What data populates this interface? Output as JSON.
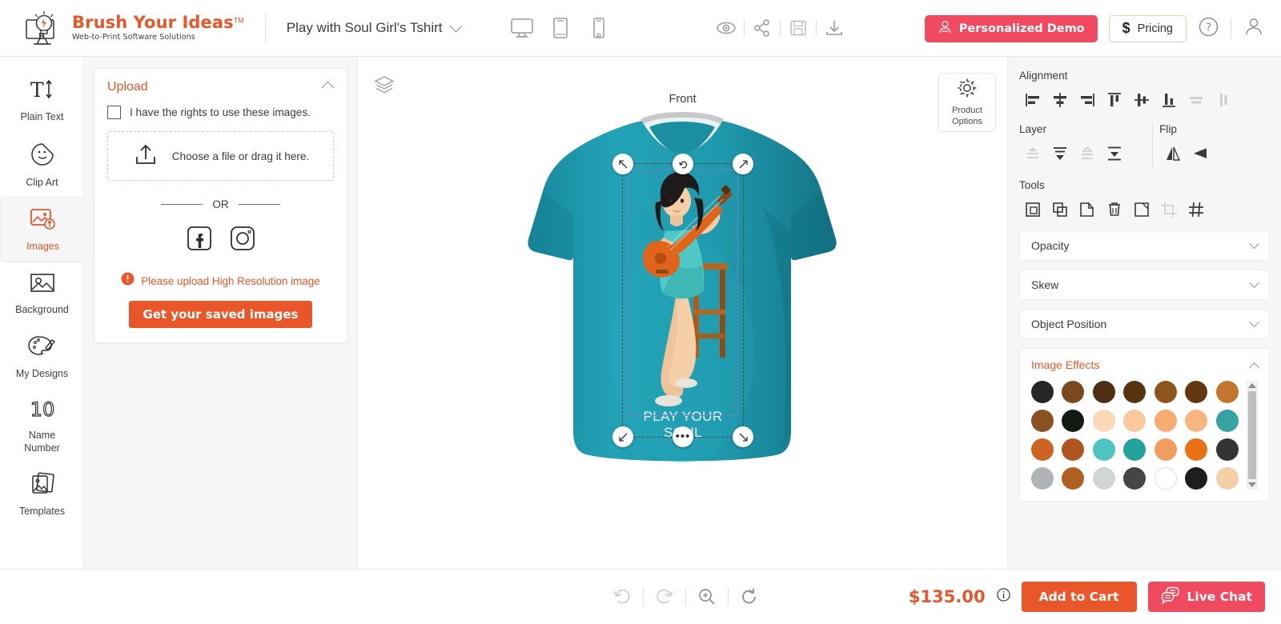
{
  "header": {
    "logo_title": "Brush Your Ideas",
    "logo_tm": "TM",
    "logo_sub": "Web-to-Print Software Solutions",
    "doc_title": "Play with Soul Girl's Tshirt",
    "devices": [
      {
        "name": "desktop-view",
        "label": "Desktop"
      },
      {
        "name": "tablet-view",
        "label": "Tablet"
      },
      {
        "name": "mobile-view",
        "label": "Mobile"
      }
    ],
    "actions": [
      {
        "name": "preview-icon",
        "label": "Preview"
      },
      {
        "name": "share-icon",
        "label": "Share"
      },
      {
        "name": "save-icon",
        "label": "Save"
      },
      {
        "name": "download-icon",
        "label": "Download"
      }
    ],
    "demo_button": "Personalized Demo",
    "pricing_button": "Pricing",
    "help_icon": "help-circle-icon",
    "account_icon": "user-account-icon"
  },
  "sidebar": {
    "items": [
      {
        "label": "Plain Text",
        "icon": "plain-text-icon",
        "active": false
      },
      {
        "label": "Clip Art",
        "icon": "clip-art-icon",
        "active": false
      },
      {
        "label": "Images",
        "icon": "images-icon",
        "active": true
      },
      {
        "label": "Background",
        "icon": "background-icon",
        "active": false
      },
      {
        "label": "My Designs",
        "icon": "palette-icon",
        "active": false
      },
      {
        "label": "Name\nNumber",
        "icon": "name-number-icon",
        "active": false
      },
      {
        "label": "Templates",
        "icon": "templates-icon",
        "active": false
      }
    ],
    "name_number_line1": "Name",
    "name_number_line2": "Number",
    "name_number_glyph": "10"
  },
  "upload_panel": {
    "title": "Upload",
    "rights_checkbox_label": "I have the rights to use these images.",
    "rights_checked": false,
    "dropzone_text": "Choose a file or drag it here.",
    "or_text": "OR",
    "social": [
      {
        "name": "facebook-icon",
        "label": "Facebook"
      },
      {
        "name": "instagram-icon",
        "label": "Instagram"
      }
    ],
    "warning_text": "Please upload High Resolution image",
    "saved_images_button": "Get your saved images"
  },
  "canvas": {
    "layers_icon": "layers-icon",
    "side_label": "Front",
    "design_text": "PLAY YOUR SOUL",
    "shirt_color": "#1f9bb0",
    "selection": {
      "handles": [
        {
          "name": "rotate-handle",
          "glyph": "↖"
        },
        {
          "name": "flip-handle",
          "glyph": "↻"
        },
        {
          "name": "resize-handle-tr",
          "glyph": "↗"
        },
        {
          "name": "resize-handle-bl",
          "glyph": "↙"
        },
        {
          "name": "more-options-handle",
          "glyph": "•••"
        },
        {
          "name": "resize-handle-br",
          "glyph": "↘"
        }
      ]
    }
  },
  "product_options": {
    "line1": "Product",
    "line2": "Options",
    "icon": "gear-icon"
  },
  "right_panel": {
    "alignment_title": "Alignment",
    "alignment_buttons": [
      {
        "name": "align-left-icon",
        "enabled": true
      },
      {
        "name": "align-center-horizontal-icon",
        "enabled": true
      },
      {
        "name": "align-right-icon",
        "enabled": true
      },
      {
        "name": "align-top-icon",
        "enabled": true
      },
      {
        "name": "align-middle-vertical-icon",
        "enabled": true
      },
      {
        "name": "align-bottom-icon",
        "enabled": true
      },
      {
        "name": "distribute-horizontal-icon",
        "enabled": false
      },
      {
        "name": "distribute-vertical-icon",
        "enabled": false
      }
    ],
    "layer_title": "Layer",
    "layer_buttons": [
      {
        "name": "bring-forward-icon",
        "enabled": false
      },
      {
        "name": "bring-to-front-icon",
        "enabled": true
      },
      {
        "name": "send-backward-icon",
        "enabled": false
      },
      {
        "name": "send-to-back-icon",
        "enabled": true
      }
    ],
    "flip_title": "Flip",
    "flip_buttons": [
      {
        "name": "flip-horizontal-icon",
        "enabled": true
      },
      {
        "name": "flip-vertical-icon",
        "enabled": true
      }
    ],
    "tools_title": "Tools",
    "tools_buttons": [
      {
        "name": "select-all-icon",
        "enabled": true
      },
      {
        "name": "duplicate-icon",
        "enabled": true
      },
      {
        "name": "copy-icon",
        "enabled": true
      },
      {
        "name": "delete-icon",
        "enabled": true
      },
      {
        "name": "resize-icon",
        "enabled": true
      },
      {
        "name": "crop-icon",
        "enabled": false
      },
      {
        "name": "grid-icon",
        "enabled": true
      }
    ],
    "accordions": [
      {
        "label": "Opacity",
        "expanded": false
      },
      {
        "label": "Skew",
        "expanded": false
      },
      {
        "label": "Object Position",
        "expanded": false
      }
    ],
    "effects_title": "Image Effects",
    "effects_expanded": true,
    "swatches": [
      "#262626",
      "#7a4a1e",
      "#4e2e14",
      "#573312",
      "#8c551e",
      "#63380f",
      "#c2762c",
      "#8a5222",
      "#161a15",
      "#fcd8b6",
      "#f9c99c",
      "#f7ad72",
      "#f8b681",
      "#36a3a0",
      "#cc6323",
      "#b05521",
      "#4fc5c2",
      "#23a39c",
      "#ef9e5e",
      "#ea7016",
      "#333333",
      "#b0b4b7",
      "#b05f21",
      "#d2d5d6",
      "#454545",
      "#ffffff",
      "#1e1e1e",
      "#f3d0a5"
    ]
  },
  "footer": {
    "tools": [
      {
        "name": "undo-icon",
        "enabled": false
      },
      {
        "name": "redo-icon",
        "enabled": false
      },
      {
        "name": "zoom-icon",
        "enabled": true
      },
      {
        "name": "reset-icon",
        "enabled": true
      }
    ],
    "price": "$135.00",
    "price_info_icon": "info-icon",
    "add_to_cart": "Add to Cart",
    "live_chat": "Live Chat"
  },
  "colors": {
    "brand_orange": "#e8562a",
    "brand_pink": "#f1495f",
    "shirt_teal": "#1f9bb0"
  }
}
